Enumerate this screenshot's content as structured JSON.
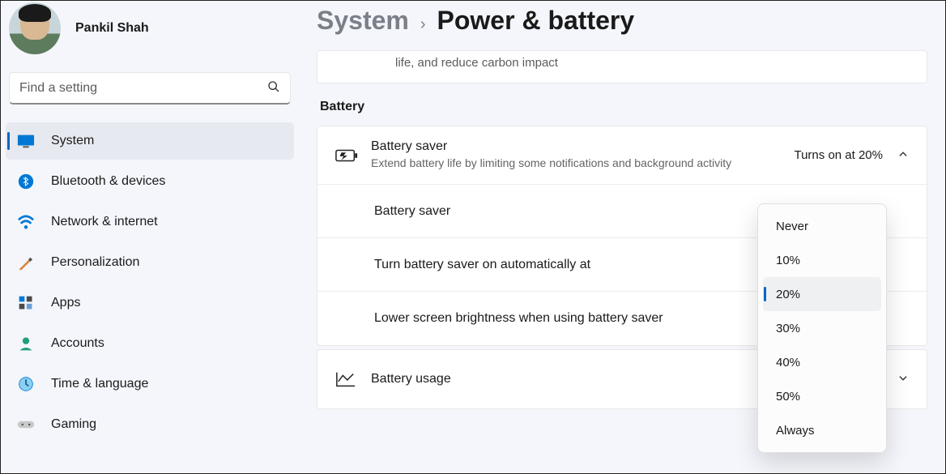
{
  "profile": {
    "name": "Pankil Shah"
  },
  "search": {
    "placeholder": "Find a setting"
  },
  "nav": {
    "items": [
      {
        "label": "System",
        "icon": "system",
        "selected": true
      },
      {
        "label": "Bluetooth & devices",
        "icon": "bluetooth",
        "selected": false
      },
      {
        "label": "Network & internet",
        "icon": "network",
        "selected": false
      },
      {
        "label": "Personalization",
        "icon": "personalization",
        "selected": false
      },
      {
        "label": "Apps",
        "icon": "apps",
        "selected": false
      },
      {
        "label": "Accounts",
        "icon": "accounts",
        "selected": false
      },
      {
        "label": "Time & language",
        "icon": "time",
        "selected": false
      },
      {
        "label": "Gaming",
        "icon": "gaming",
        "selected": false
      }
    ]
  },
  "breadcrumb": {
    "parent": "System",
    "current": "Power & battery"
  },
  "top_fragment": "life, and reduce carbon impact",
  "section": {
    "label": "Battery"
  },
  "battery_saver": {
    "title": "Battery saver",
    "subtitle": "Extend battery life by limiting some notifications and background activity",
    "value": "Turns on at 20%"
  },
  "rows": {
    "saver_toggle_label": "Battery saver",
    "auto_label": "Turn battery saver on automatically at",
    "brightness_label": "Lower screen brightness when using battery saver"
  },
  "usage": {
    "title": "Battery usage"
  },
  "dropdown": {
    "options": [
      "Never",
      "10%",
      "20%",
      "30%",
      "40%",
      "50%",
      "Always"
    ],
    "selected_index": 2
  }
}
